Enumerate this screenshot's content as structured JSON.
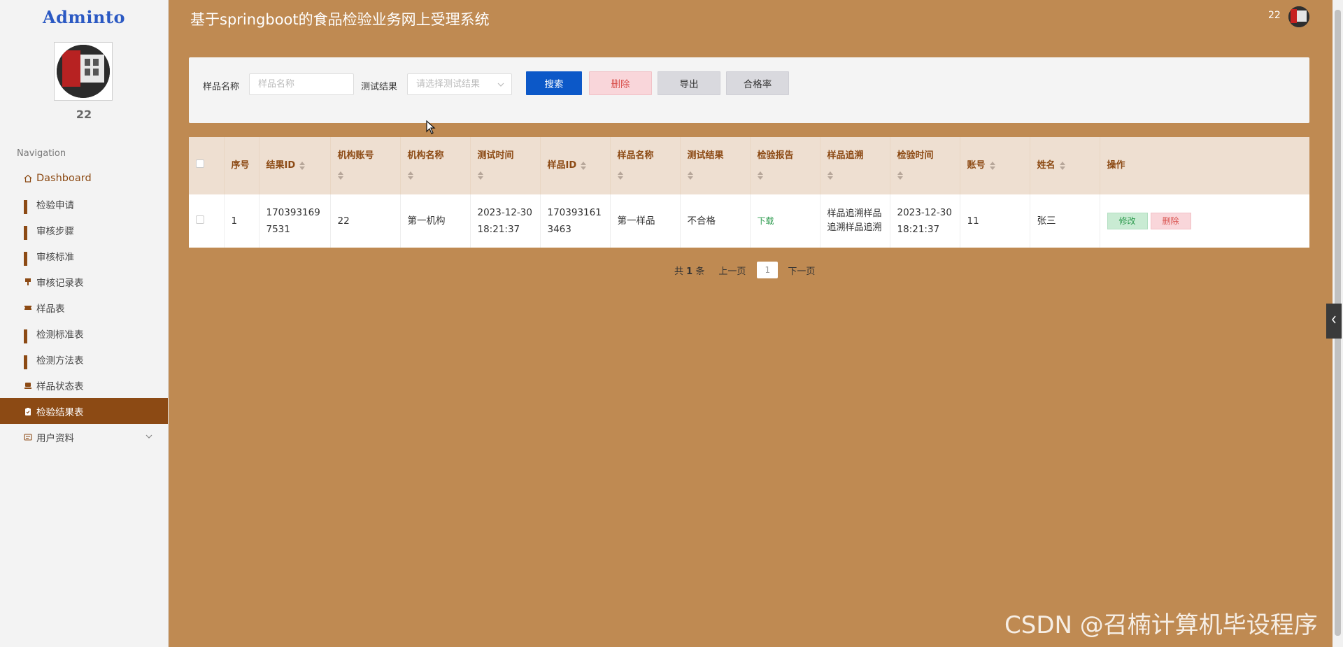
{
  "app": {
    "brand": "Adminto",
    "title": "基于springboot的食品检验业务网上受理系统",
    "top_username": "22"
  },
  "sidebar": {
    "username": "22",
    "nav_heading": "Navigation",
    "items": [
      {
        "label": "Dashboard",
        "icon": "home-icon",
        "active": false
      },
      {
        "label": "检验申请",
        "icon": "grid-icon",
        "active": false
      },
      {
        "label": "审核步骤",
        "icon": "grid-icon",
        "active": false
      },
      {
        "label": "审核标准",
        "icon": "grid-icon",
        "active": false
      },
      {
        "label": "审核记录表",
        "icon": "pin-icon",
        "active": false
      },
      {
        "label": "样品表",
        "icon": "ticket-icon",
        "active": false
      },
      {
        "label": "检测标准表",
        "icon": "grid-icon",
        "active": false
      },
      {
        "label": "检测方法表",
        "icon": "grid-icon",
        "active": false
      },
      {
        "label": "样品状态表",
        "icon": "stamp-icon",
        "active": false
      },
      {
        "label": "检验结果表",
        "icon": "clipboard-icon",
        "active": true
      },
      {
        "label": "用户资料",
        "icon": "card-icon",
        "active": false,
        "has_submenu": true
      }
    ]
  },
  "search": {
    "sample_name_label": "样品名称",
    "sample_name_placeholder": "样品名称",
    "test_result_label": "测试结果",
    "test_result_placeholder": "请选择测试结果",
    "search_button": "搜索",
    "delete_button": "删除",
    "export_button": "导出",
    "pass_rate_button": "合格率"
  },
  "table": {
    "columns": [
      "序号",
      "结果ID",
      "机构账号",
      "机构名称",
      "测试时间",
      "样品ID",
      "样品名称",
      "测试结果",
      "检验报告",
      "样品追溯",
      "检验时间",
      "账号",
      "姓名",
      "操作"
    ],
    "rows": [
      {
        "index": "1",
        "result_id": "1703931697531",
        "org_account": "22",
        "org_name": "第一机构",
        "test_time": "2023-12-30 18:21:37",
        "sample_id": "1703931613463",
        "sample_name": "第一样品",
        "test_result": "不合格",
        "report": "下载",
        "trace": "样品追溯样品追溯样品追溯",
        "inspect_time": "2023-12-30 18:21:37",
        "account": "11",
        "name": "张三",
        "edit": "修改",
        "delete": "删除"
      }
    ]
  },
  "pagination": {
    "total_prefix": "共",
    "total": "1",
    "total_suffix": "条",
    "prev": "上一页",
    "current": "1",
    "next": "下一页"
  },
  "watermark": "CSDN @召楠计算机毕设程序",
  "colors": {
    "page_bg": "#BF8A52",
    "accent": "#8C4A14",
    "primary": "#0C58C8"
  }
}
